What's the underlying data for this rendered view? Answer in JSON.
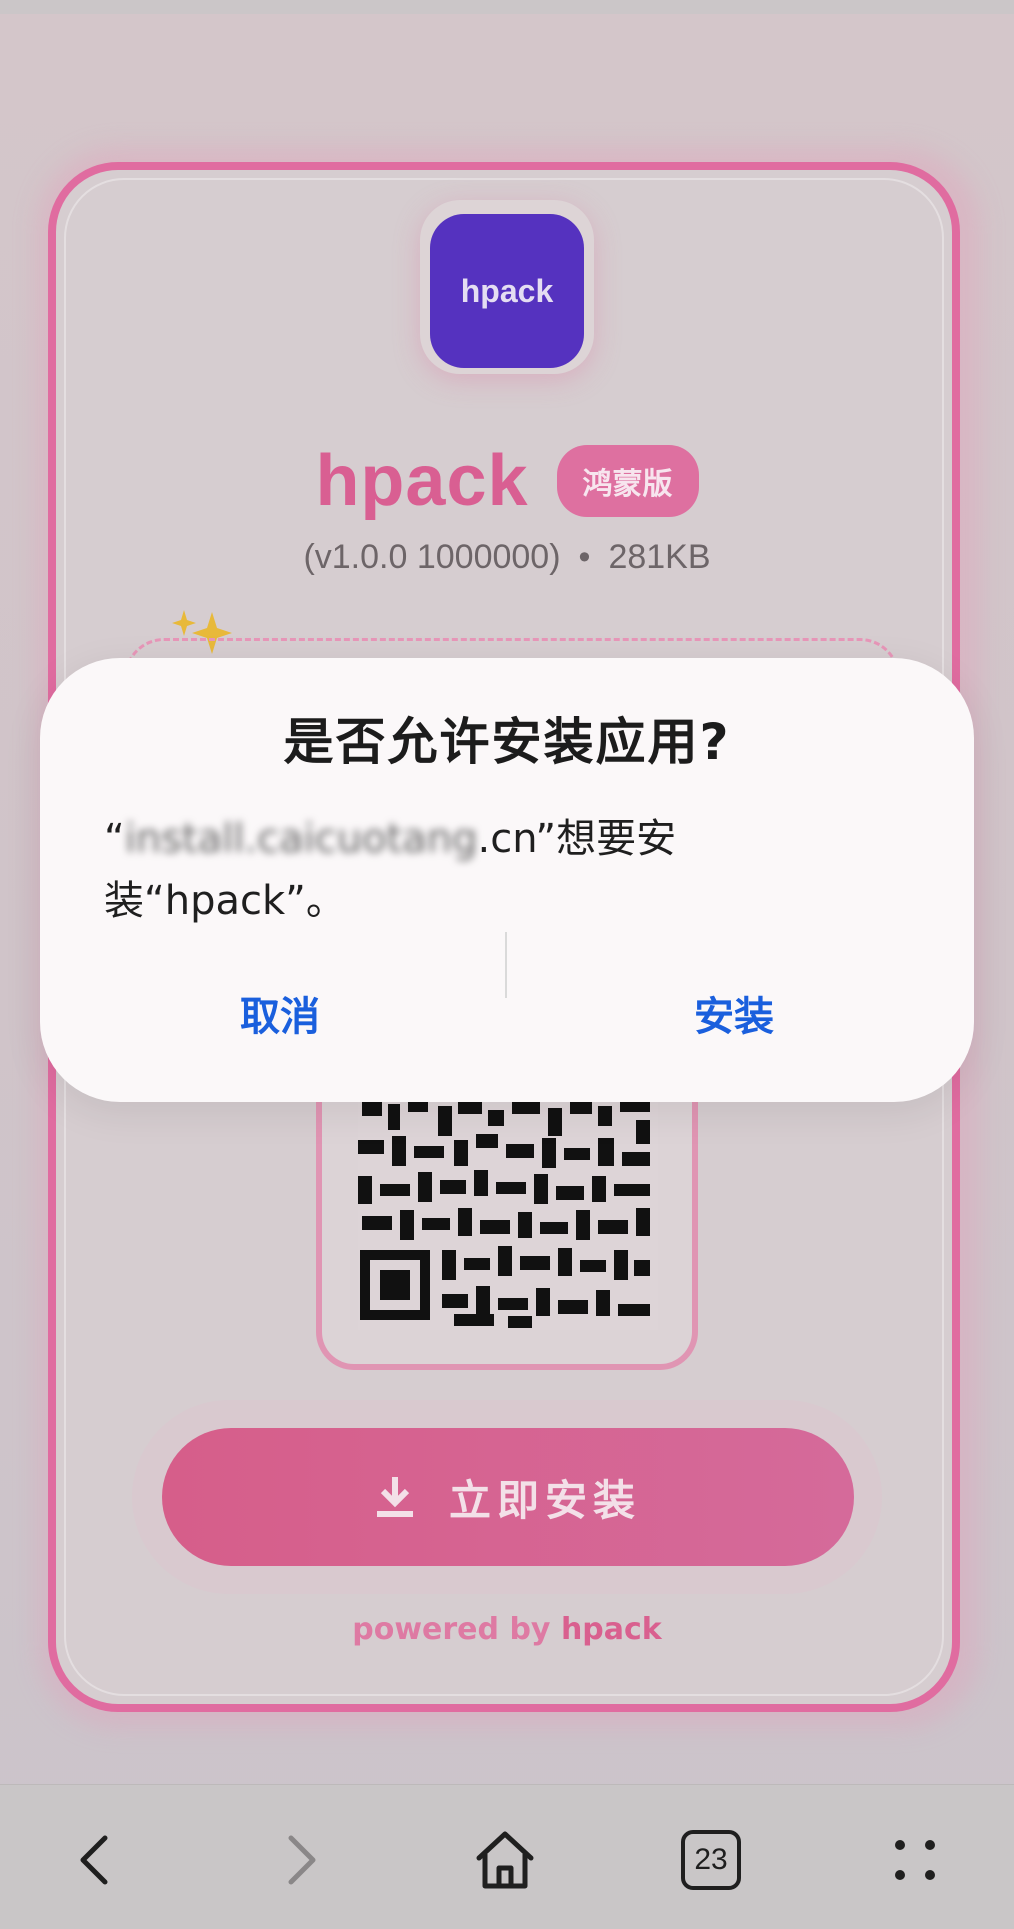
{
  "app": {
    "icon_label": "hpack",
    "name": "hpack",
    "badge": "鸿蒙版",
    "version": "(v1.0.0 1000000)",
    "separator": "•",
    "size": "281KB",
    "install_button_label": "立即安装",
    "powered_prefix": "powered by",
    "powered_brand": "hpack"
  },
  "dialog": {
    "title": "是否允许安装应用?",
    "msg_open_quote": "“",
    "msg_host_blurred": "install.caicuotang",
    "msg_host_suffix": ".cn",
    "msg_after_host": "”想要安",
    "msg_line2": "装“hpack”。",
    "cancel_label": "取消",
    "install_label": "安装"
  },
  "browser_nav": {
    "tab_count": "23",
    "back_icon": "chevron-left-icon",
    "forward_icon": "chevron-right-icon",
    "home_icon": "home-icon",
    "tabs_icon": "tabs-icon",
    "menu_icon": "grid-dots-icon"
  },
  "colors": {
    "accent_pink": "#d95f92",
    "icon_purple": "#5532bf",
    "dialog_link_blue": "#1a5fdd"
  }
}
